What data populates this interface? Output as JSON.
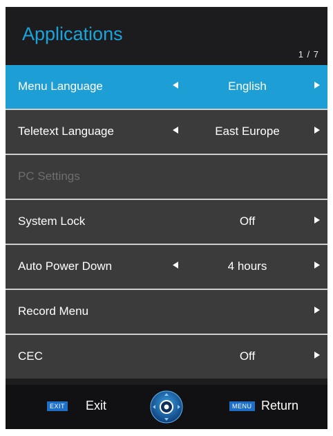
{
  "header": {
    "title": "Applications",
    "page_indicator": "1 / 7"
  },
  "rows": [
    {
      "label": "Menu Language",
      "value": "English",
      "left_arrow": true,
      "right_arrow": true,
      "selected": true,
      "disabled": false
    },
    {
      "label": "Teletext Language",
      "value": "East Europe",
      "left_arrow": true,
      "right_arrow": true,
      "selected": false,
      "disabled": false
    },
    {
      "label": "PC Settings",
      "value": "",
      "left_arrow": false,
      "right_arrow": false,
      "selected": false,
      "disabled": true
    },
    {
      "label": "System Lock",
      "value": "Off",
      "left_arrow": false,
      "right_arrow": true,
      "selected": false,
      "disabled": false
    },
    {
      "label": "Auto Power Down",
      "value": "4 hours",
      "left_arrow": true,
      "right_arrow": true,
      "selected": false,
      "disabled": false
    },
    {
      "label": "Record Menu",
      "value": "",
      "left_arrow": false,
      "right_arrow": true,
      "selected": false,
      "disabled": false
    },
    {
      "label": "CEC",
      "value": "Off",
      "left_arrow": false,
      "right_arrow": true,
      "selected": false,
      "disabled": false
    }
  ],
  "footer": {
    "exit_key": "EXIT",
    "exit_label": "Exit",
    "menu_key": "MENU",
    "return_label": "Return",
    "nav_icon": "dpad-navigation-icon"
  },
  "colors": {
    "accent": "#1d9fd6",
    "title": "#1ba3dc",
    "row_bg": "#3c3b3b",
    "panel_bg": "#1d1d1f",
    "key_bg": "#1e6fc8"
  }
}
